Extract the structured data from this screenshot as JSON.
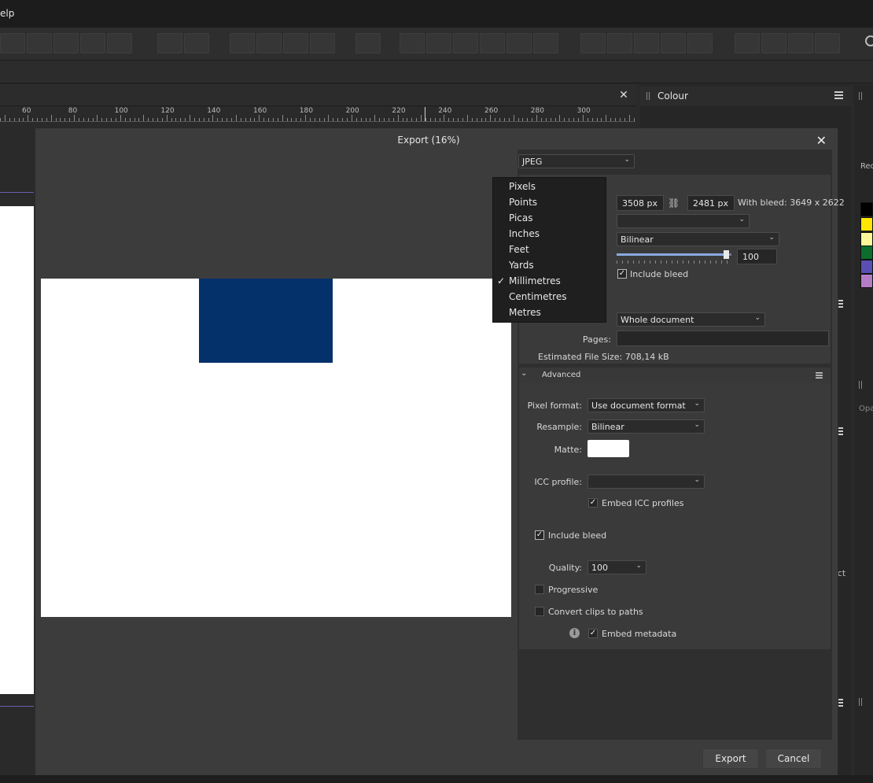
{
  "app": {
    "menu_partial": "elp"
  },
  "document": {
    "ruler_labels": [
      "60",
      "80",
      "100",
      "120",
      "140",
      "160",
      "180",
      "200",
      "220",
      "240",
      "260",
      "280",
      "300"
    ],
    "close_glyph": "✕"
  },
  "studio": {
    "colour_tab": "Colour",
    "recent_label": "Rec",
    "opacity_label": "Opa",
    "select_partial": "ect",
    "swatch_colors": [
      "#000000",
      "#ffe600",
      "#fff79a",
      "#0c6d2c",
      "#5a4fb2",
      "#b57cc6"
    ]
  },
  "dialog": {
    "title": "Export (16%)",
    "close_glyph": "✕",
    "format": "JPEG",
    "size": {
      "width": "3508 px",
      "height": "2481 px",
      "with_bleed": "With bleed: 3649 x 2622"
    },
    "resample_top": "Bilinear",
    "slider_value": "100",
    "slider_level_percent": 96,
    "include_bleed_top": "Include bleed",
    "area_value": "Whole document",
    "pages_label": "Pages:",
    "estimated_size": "Estimated File Size: 708,14 kB",
    "advanced": {
      "title": "Advanced",
      "pixel_format_label": "Pixel format:",
      "pixel_format_value": "Use document format",
      "resample_label": "Resample:",
      "resample_value": "Bilinear",
      "matte_label": "Matte:",
      "matte_color": "#ffffff",
      "icc_label": "ICC profile:",
      "icc_value": "",
      "embed_icc": "Embed ICC profiles",
      "include_bleed": "Include bleed",
      "quality_label": "Quality:",
      "quality_value": "100",
      "progressive": "Progressive",
      "convert_clips": "Convert clips to paths",
      "embed_metadata": "Embed metadata"
    },
    "buttons": {
      "export": "Export",
      "cancel": "Cancel"
    }
  },
  "units_menu": {
    "items": [
      "Pixels",
      "Points",
      "Picas",
      "Inches",
      "Feet",
      "Yards",
      "Millimetres",
      "Centimetres",
      "Metres"
    ],
    "selected": "Millimetres",
    "check_glyph": "✓"
  },
  "colors": {
    "accent_blue": "#05316b",
    "panel_bg": "#3c3c3c"
  }
}
